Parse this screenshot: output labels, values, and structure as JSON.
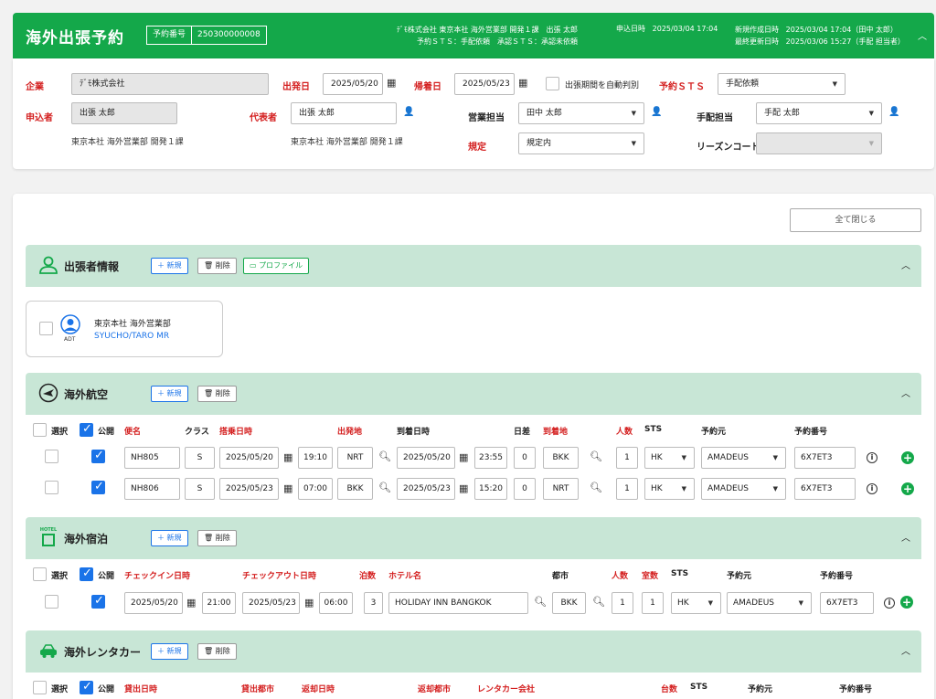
{
  "header": {
    "title": "海外出張予約",
    "reservation_label": "予約番号",
    "reservation_no": "250300000008",
    "company_line": "ﾃﾞﾓ株式会社 東京本社 海外営業部 開発１課　出張 太郎",
    "sts_line": "予約ＳＴＳ：手配依頼　承認ＳＴＳ：承認未依頼",
    "apply_label": "申込日時",
    "apply_value": "2025/03/04 17:04",
    "created_label": "新規作成日時",
    "created_value": "2025/03/04 17:04（田中 太郎）",
    "updated_label": "最終更新日時",
    "updated_value": "2025/03/06 15:27（手配 担当者）"
  },
  "form": {
    "company_label": "企業",
    "company_value": "ﾃﾞﾓ株式会社",
    "depart_label": "出発日",
    "depart_value": "2025/05/20",
    "return_label": "帰着日",
    "return_value": "2025/05/23",
    "auto_period_label": "出張期間を自動判別",
    "sts_label": "予約ＳＴＳ",
    "sts_value": "手配依頼",
    "applicant_label": "申込者",
    "applicant_value": "出張 太郎",
    "applicant_dept": "東京本社 海外営業部 開発１課",
    "rep_label": "代表者",
    "rep_value": "出張 太郎",
    "rep_dept": "東京本社 海外営業部 開発１課",
    "sales_label": "営業担当",
    "sales_value": "田中 太郎",
    "arrange_label": "手配担当",
    "arrange_value": "手配 太郎",
    "rule_label": "規定",
    "rule_value": "規定内",
    "reason_label": "リーズンコード",
    "reason_value": ""
  },
  "main": {
    "close_all": "全て閉じる",
    "new_btn": "＋ 新規",
    "delete_btn": "削除",
    "profile_btn": "プロファイル",
    "select_label": "選択",
    "public_label": "公開"
  },
  "traveler": {
    "title": "出張者情報",
    "dept": "東京本社 海外営業部",
    "name": "SYUCHO/TARO MR",
    "type": "ADT"
  },
  "air": {
    "title": "海外航空",
    "headers": [
      "便名",
      "クラス",
      "搭乗日時",
      "出発地",
      "到着日時",
      "日差",
      "到着地",
      "人数",
      "STS",
      "予約元",
      "予約番号"
    ],
    "rows": [
      {
        "flight": "NH805",
        "cls": "S",
        "dep_date": "2025/05/20",
        "dep_time": "19:10",
        "from": "NRT",
        "arr_date": "2025/05/20",
        "arr_time": "23:55",
        "diff": "0",
        "to": "BKK",
        "pax": "1",
        "sts": "HK",
        "src": "AMADEUS",
        "pnr": "6X7ET3"
      },
      {
        "flight": "NH806",
        "cls": "S",
        "dep_date": "2025/05/23",
        "dep_time": "07:00",
        "from": "BKK",
        "arr_date": "2025/05/23",
        "arr_time": "15:20",
        "diff": "0",
        "to": "NRT",
        "pax": "1",
        "sts": "HK",
        "src": "AMADEUS",
        "pnr": "6X7ET3"
      }
    ]
  },
  "hotel": {
    "title": "海外宿泊",
    "icon_text": "HOTEL",
    "headers": [
      "チェックイン日時",
      "チェックアウト日時",
      "泊数",
      "ホテル名",
      "都市",
      "人数",
      "室数",
      "STS",
      "予約元",
      "予約番号"
    ],
    "row": {
      "in_date": "2025/05/20",
      "in_time": "21:00",
      "out_date": "2025/05/23",
      "out_time": "06:00",
      "nights": "3",
      "name": "HOLIDAY INN BANGKOK",
      "city": "BKK",
      "pax": "1",
      "rooms": "1",
      "sts": "HK",
      "src": "AMADEUS",
      "pnr": "6X7ET3"
    }
  },
  "car": {
    "title": "海外レンタカー",
    "headers": [
      "貸出日時",
      "貸出都市",
      "返却日時",
      "返却都市",
      "レンタカー会社",
      "台数",
      "STS",
      "予約元",
      "予約番号"
    ]
  }
}
